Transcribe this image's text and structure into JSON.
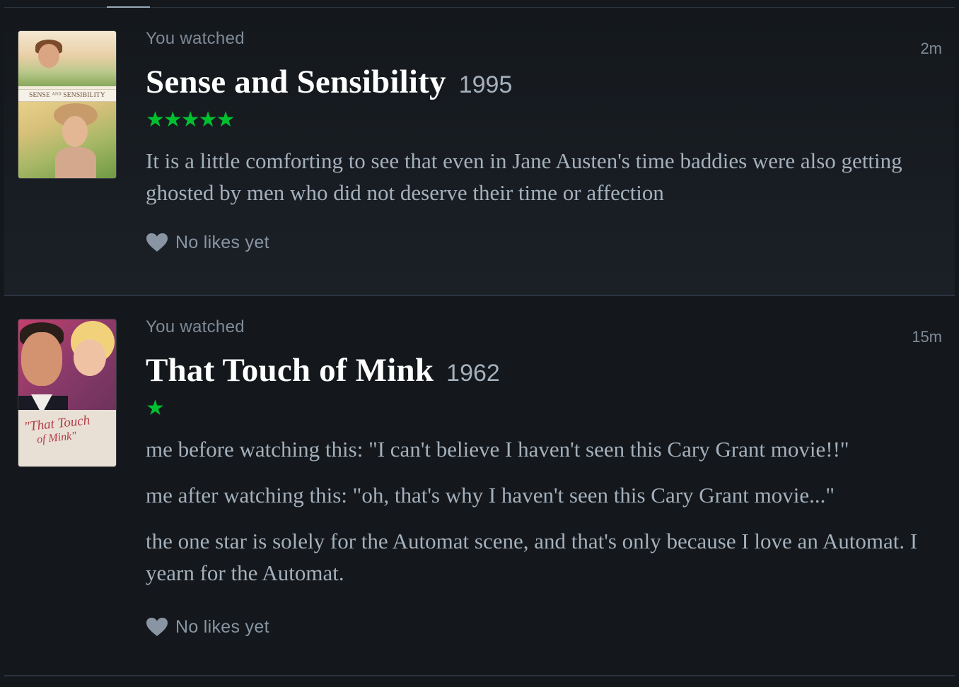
{
  "entries": [
    {
      "label": "You watched",
      "time": "2m",
      "title": "Sense and Sensibility",
      "year": "1995",
      "rating_stars": "★★★★★",
      "rating": 5,
      "poster_text": "SENSE ᴬᴺᴰ SENSIBILITY",
      "review": [
        "It is a little comforting to see that even in Jane Austen's time baddies were also getting ghosted by men who did not deserve their time or affection"
      ],
      "likes": "No likes yet"
    },
    {
      "label": "You watched",
      "time": "15m",
      "title": "That Touch of Mink",
      "year": "1962",
      "rating_stars": "★",
      "rating": 1,
      "poster_text_line1": "\"That Touch",
      "poster_text_line2": "of Mink\"",
      "review": [
        "me before watching this: \"I can't believe I haven't seen this Cary Grant movie!!\"",
        "me after watching this: \"oh, that's why I haven't seen this Cary Grant movie...\"",
        "the one star is solely for the Automat scene, and that's only because I love an Automat. I yearn for the Automat."
      ],
      "likes": "No likes yet"
    }
  ],
  "colors": {
    "background": "#14181c",
    "star": "#00c030",
    "title": "#ffffff",
    "muted": "#7f8b98",
    "review": "#a4b0bc"
  }
}
